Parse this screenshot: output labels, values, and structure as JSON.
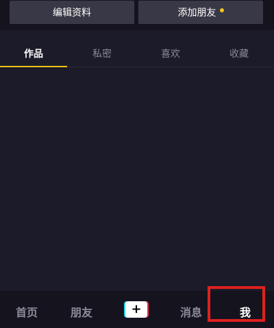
{
  "colors": {
    "accent_yellow": "#f5c518",
    "tab_underline": "#f5c518",
    "tiktok_cyan": "#20d5ec",
    "tiktok_red": "#fe2c55",
    "annotation_red": "#e02020"
  },
  "profile_actions": {
    "edit_profile_label": "编辑资料",
    "add_friends_label": "添加朋友"
  },
  "tabs": [
    {
      "label": "作品",
      "active": true
    },
    {
      "label": "私密",
      "active": false
    },
    {
      "label": "喜欢",
      "active": false
    },
    {
      "label": "收藏",
      "active": false
    }
  ],
  "bottom_nav": {
    "home_label": "首页",
    "friends_label": "朋友",
    "create_label": "+",
    "messages_label": "消息",
    "me_label": "我",
    "active": "我"
  }
}
